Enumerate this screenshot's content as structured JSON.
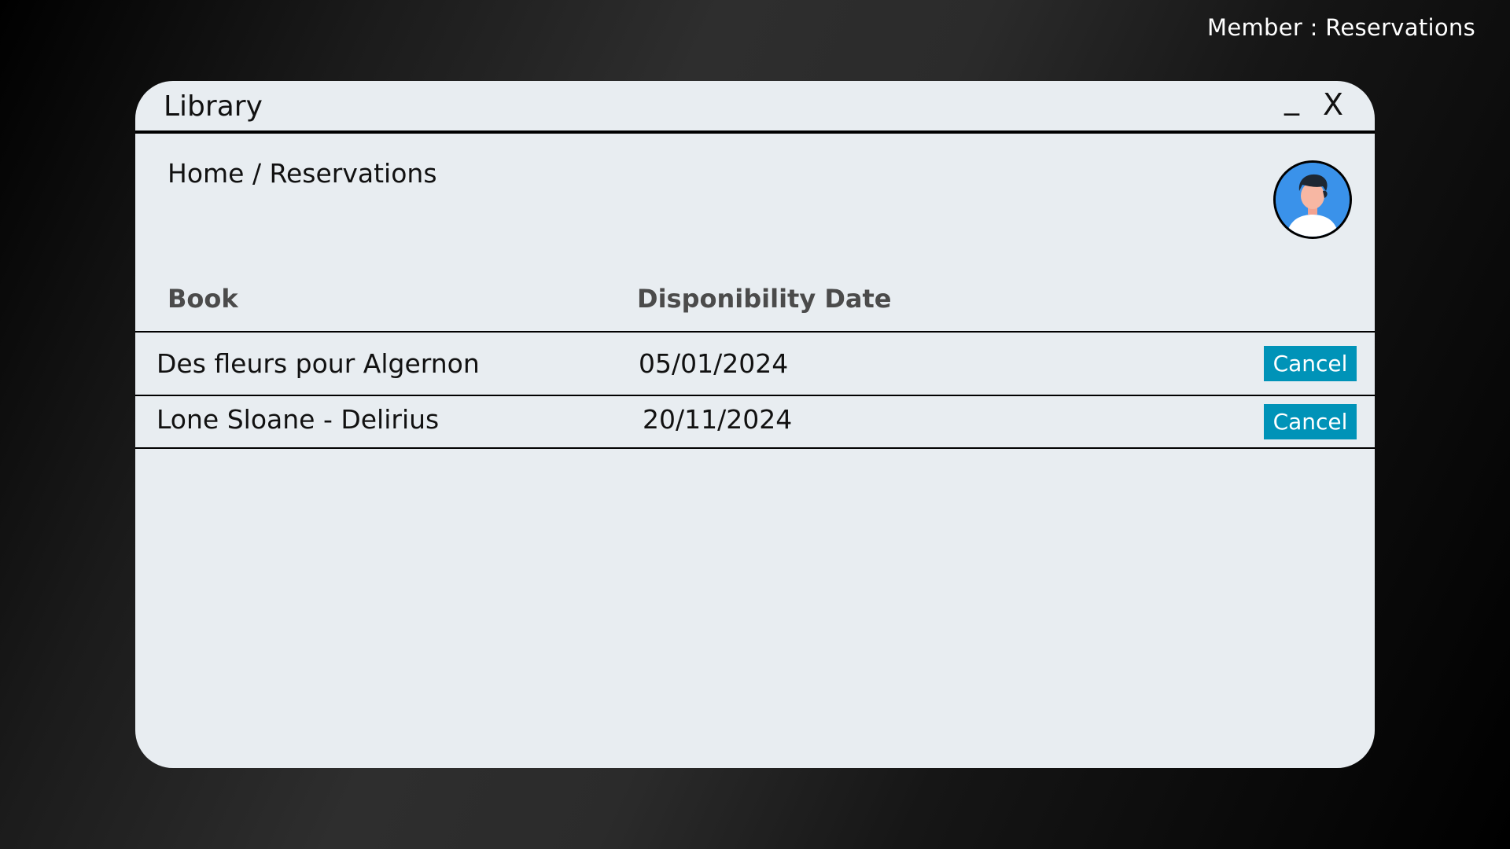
{
  "page_caption": "Member : Reservations",
  "window": {
    "title": "Library",
    "minimize_label": "_",
    "close_label": "X"
  },
  "breadcrumb": "Home / Reservations",
  "avatar": {
    "icon": "user-avatar-icon"
  },
  "table": {
    "headers": [
      "Book",
      "Disponibility Date"
    ],
    "rows": [
      {
        "book": "Des fleurs pour Algernon",
        "date": "05/01/2024",
        "action": "Cancel"
      },
      {
        "book": "Lone Sloane - Delirius",
        "date": "20/11/2024",
        "action": "Cancel"
      }
    ]
  },
  "colors": {
    "window_bg": "#e8edf1",
    "button_bg": "#0093b8",
    "header_text": "#4b4b4b",
    "avatar_bg": "#3a92ea"
  }
}
